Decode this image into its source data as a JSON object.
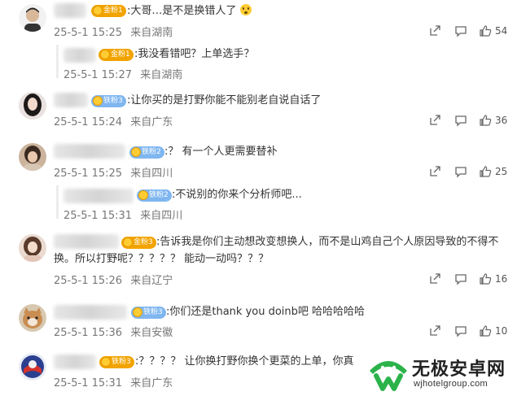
{
  "comments": [
    {
      "badge": "金粉1",
      "text": ":大哥…是不是换错人了",
      "date": "25-5-1 15:25",
      "location": "来自湖南",
      "likes": "54",
      "reply": {
        "badge": "金粉1",
        "text": ":我没看错吧？上单选手？",
        "date": "25-5-1 15:27",
        "location": "来自湖南"
      }
    },
    {
      "badge": "铁粉3",
      "text": ":让你买的是打野你能不能别老自说自话了",
      "date": "25-5-1 15:24",
      "location": "来自广东",
      "likes": "36"
    },
    {
      "badge": "铁粉2",
      "text": ":？ 有一个人更需要替补",
      "date": "25-5-1 15:25",
      "location": "来自四川",
      "likes": "25",
      "reply": {
        "badge": "铁粉2",
        "text": ":不说别的你来个分析师吧...",
        "date": "25-5-1 15:31",
        "location": "来自四川"
      }
    },
    {
      "badge": "金粉3",
      "text_line1": ":告诉我是你们主动想改变想换人，而不是山鸡自己个人原因导致的不得不",
      "text_line2": "换。所以打野呢？？？？？ 能动一动吗？？？",
      "date": "25-5-1 15:26",
      "location": "来自辽宁",
      "likes": "16"
    },
    {
      "badge": "铁粉3",
      "text": ":你们还是thank you  doinb吧 哈哈哈哈哈",
      "date": "25-5-1 15:36",
      "location": "来自安徽",
      "likes": "10"
    },
    {
      "badge": "铁粉3",
      "text": ":？？？？ 让你换打野你换个更菜的上单，你真",
      "date": "25-5-1 15:31",
      "location": "来自广东"
    }
  ],
  "watermark": {
    "title": "无极安卓网",
    "url": "wjhotelgroup.com"
  },
  "icons": {
    "share": "share-icon",
    "comment": "comment-icon",
    "like": "thumbs-up-icon"
  },
  "colors": {
    "gold_badge": "#f2a300",
    "iron_badge": "#7fb6f0",
    "watermark_green": "#2bb34a"
  }
}
